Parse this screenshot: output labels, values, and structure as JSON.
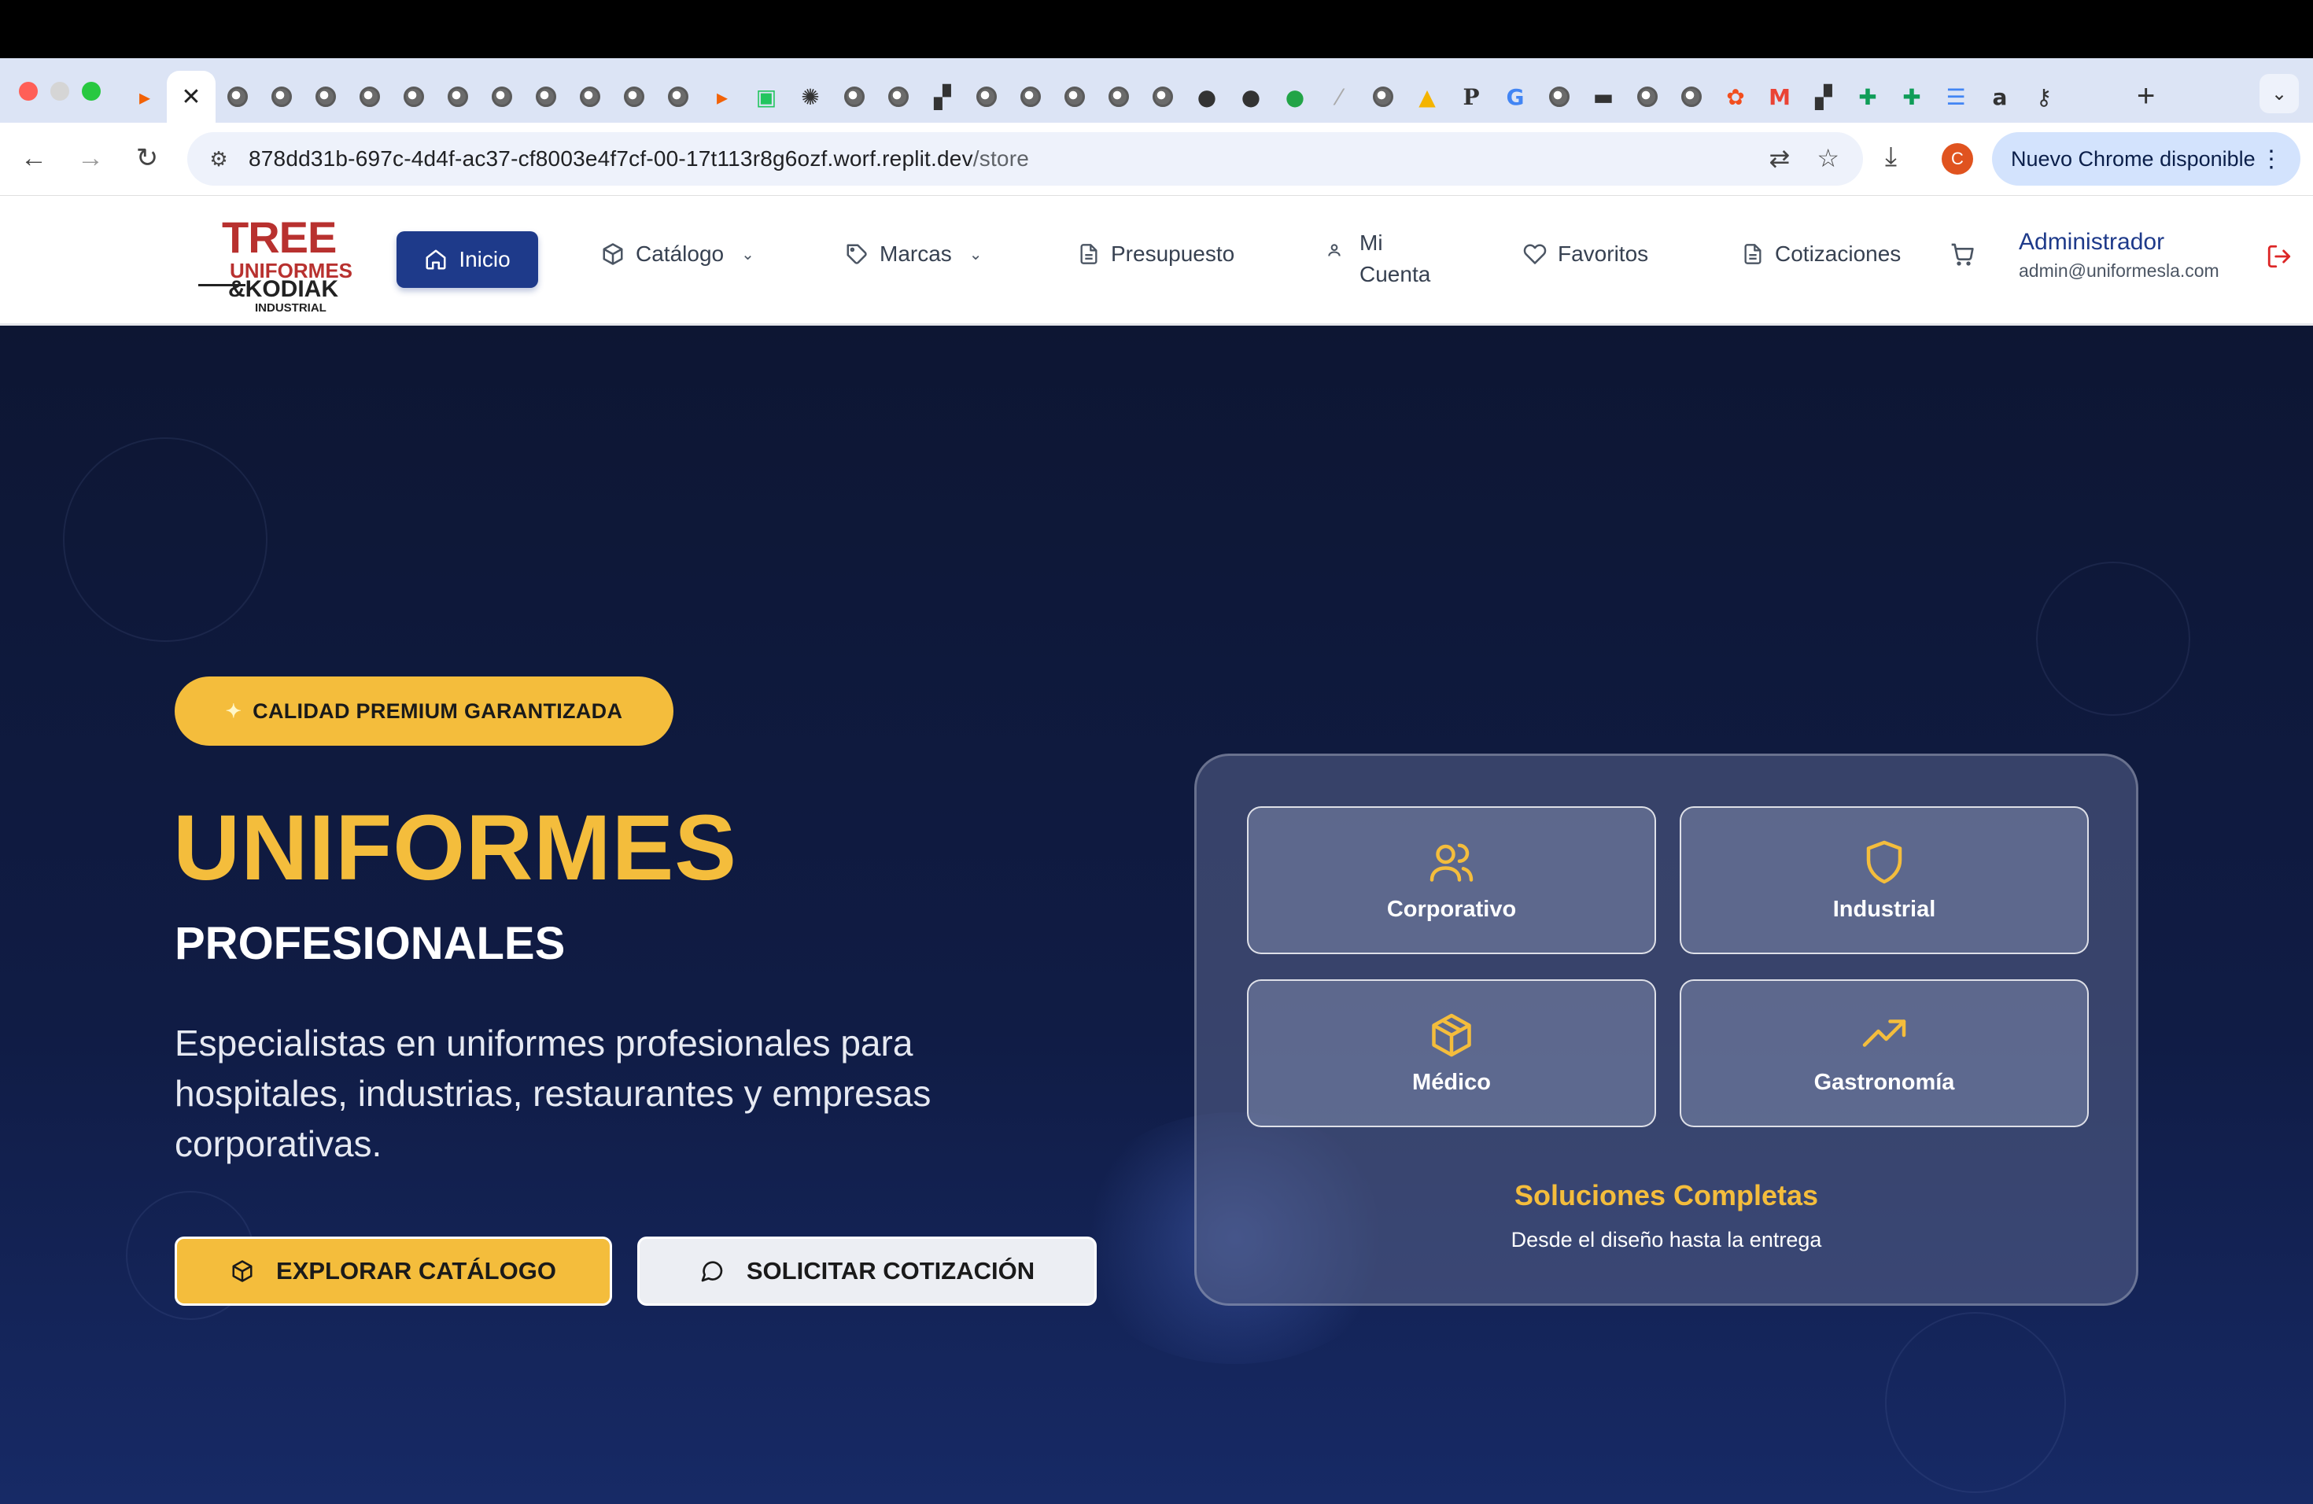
{
  "browser": {
    "active_tab_close": "✕",
    "new_tab": "+",
    "url_host": "878dd31b-697c-4d4f-ac37-cf8003e4f7cf-00-17t113r8g6ozf.worf.replit.dev",
    "url_path": "/store",
    "profile_initial": "C",
    "update_label": "Nuevo Chrome disponible"
  },
  "site": {
    "logo": {
      "line1": "TREE",
      "line2": "UNIFORMES",
      "line3": "&KODIAK",
      "line4": "INDUSTRIAL"
    },
    "nav": {
      "home": "Inicio",
      "catalog": "Catálogo",
      "brands": "Marcas",
      "budget": "Presupuesto",
      "account": "Mi Cuenta",
      "favorites": "Favoritos",
      "quotes": "Cotizaciones"
    },
    "user": {
      "name": "Administrador",
      "email": "admin@uniformesla.com"
    }
  },
  "hero": {
    "badge": "CALIDAD PREMIUM GARANTIZADA",
    "title": "UNIFORMES",
    "subtitle": "PROFESIONALES",
    "description": "Especialistas en uniformes profesionales para hospitales, industrias, restaurantes y empresas corporativas.",
    "cta_primary": "EXPLORAR CATÁLOGO",
    "cta_secondary": "SOLICITAR COTIZACIÓN",
    "categories": [
      {
        "label": "Corporativo",
        "icon": "users-icon"
      },
      {
        "label": "Industrial",
        "icon": "shield-icon"
      },
      {
        "label": "Médico",
        "icon": "box-icon"
      },
      {
        "label": "Gastronomía",
        "icon": "trending-up-icon"
      }
    ],
    "panel_title": "Soluciones Completas",
    "panel_subtitle": "Desde el diseño hasta la entrega"
  },
  "colors": {
    "accent": "#f4bd3c",
    "primary": "#1e3a8a",
    "hero_bg": "#0f1a3a",
    "logo_red": "#b8312f"
  }
}
